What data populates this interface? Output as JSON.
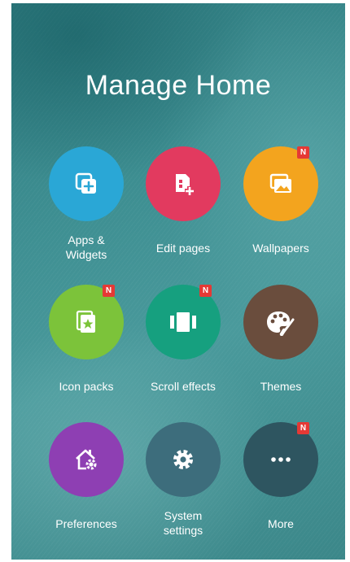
{
  "title": "Manage Home",
  "badge_text": "N",
  "colors": {
    "badge": "#e53935",
    "apps_widgets": "#2aa7d6",
    "edit_pages": "#e23a5f",
    "wallpapers": "#f3a41e",
    "icon_packs": "#7cc33a",
    "scroll_effects": "#16a07f",
    "themes": "#6a4d3d",
    "preferences": "#8e3fb3",
    "system_settings": "#3d6d7c",
    "more": "#2e5560"
  },
  "tiles": [
    {
      "label_line1": "Apps &",
      "label_line2": "Widgets",
      "icon": "apps-widgets-icon",
      "badge": false
    },
    {
      "label_line1": "Edit pages",
      "icon": "edit-pages-icon",
      "badge": false
    },
    {
      "label_line1": "Wallpapers",
      "icon": "wallpaper-icon",
      "badge": true
    },
    {
      "label_line1": "Icon packs",
      "icon": "icon-packs-icon",
      "badge": true
    },
    {
      "label_line1": "Scroll effects",
      "icon": "scroll-effects-icon",
      "badge": true
    },
    {
      "label_line1": "Themes",
      "icon": "palette-icon",
      "badge": false
    },
    {
      "label_line1": "Preferences",
      "icon": "home-settings-icon",
      "badge": false
    },
    {
      "label_line1": "System",
      "label_line2": "settings",
      "icon": "gear-icon",
      "badge": false
    },
    {
      "label_line1": "More",
      "icon": "more-dots-icon",
      "badge": true
    }
  ]
}
